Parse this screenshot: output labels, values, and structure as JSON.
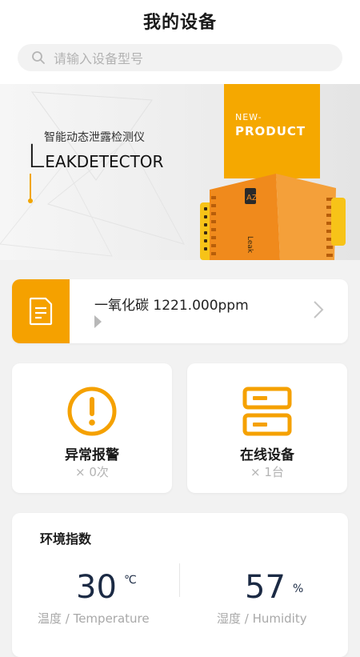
{
  "header": {
    "title": "我的设备",
    "search_placeholder": "请输入设备型号"
  },
  "banner": {
    "cn_title": "智能动态泄露检测仪",
    "en_first_letter": "L",
    "en_rest": "EAKDETECTOR",
    "tag_new": "NEW-",
    "tag_product": "PRODUCT",
    "device_brand": "Leak",
    "device_logo": "AZ"
  },
  "gas_card": {
    "text": "一氧化碳  1221.000ppm",
    "icon": "document-icon"
  },
  "stats": {
    "alarm": {
      "label": "异常报警",
      "count": "× 0次",
      "icon": "exclamation-circle-icon"
    },
    "online": {
      "label": "在线设备",
      "count": "× 1台",
      "icon": "server-icon"
    }
  },
  "environment": {
    "title": "环境指数",
    "temperature": {
      "value": "30",
      "unit": "℃",
      "label": "温度 / Temperature"
    },
    "humidity": {
      "value": "57",
      "unit": "%",
      "label": "湿度 / Humidity"
    }
  },
  "colors": {
    "accent": "#f5a100",
    "page_background": "#f2f2f2",
    "value_text": "#1b2a44"
  }
}
